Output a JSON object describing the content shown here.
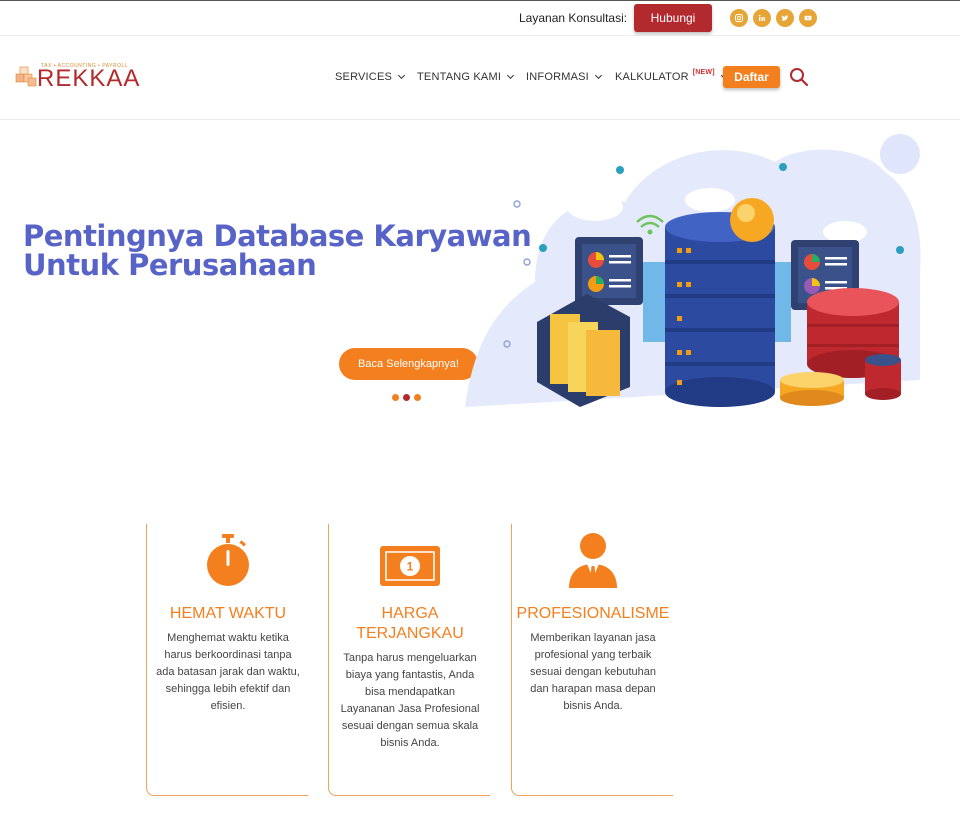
{
  "topbar": {
    "consult_label": "Layanan Konsultasi:",
    "hubungi_label": "Hubungi",
    "social": [
      "instagram-icon",
      "linkedin-icon",
      "twitter-icon",
      "youtube-icon"
    ]
  },
  "logo": {
    "tagline": "TAX • ACCOUNTING • PAYROLL",
    "brand": "REKKAA"
  },
  "nav": {
    "items": [
      "SERVICES",
      "TENTANG KAMI",
      "INFORMASI",
      "KALKULATOR"
    ],
    "new_badge": "[NEW]",
    "daftar_label": "Daftar"
  },
  "hero": {
    "title_line1": "Pentingnya Database Karyawan",
    "title_line2": "Untuk Perusahaan",
    "button_label": "Baca Selengkapnya!",
    "slides": 3,
    "active_slide": 2
  },
  "features": [
    {
      "title": "HEMAT WAKTU",
      "text": "Menghemat waktu ketika harus berkoordinasi tanpa ada batasan jarak dan waktu, sehingga lebih efektif dan efisien."
    },
    {
      "title_line1": "HARGA",
      "title_line2": "TERJANGKAU",
      "text": "Tanpa harus mengeluarkan biaya yang fantastis, Anda bisa mendapatkan Layananan Jasa Profesional sesuai dengan semua skala bisnis Anda."
    },
    {
      "title": "PROFESIONALISME",
      "text": "Memberikan layanan jasa profesional yang terbaik sesuai dengan kebutuhan dan harapan masa depan bisnis Anda."
    }
  ],
  "colors": {
    "orange": "#f37f1e",
    "red": "#b22a2d",
    "blue": "#5863c7",
    "social": "#e7a437"
  }
}
